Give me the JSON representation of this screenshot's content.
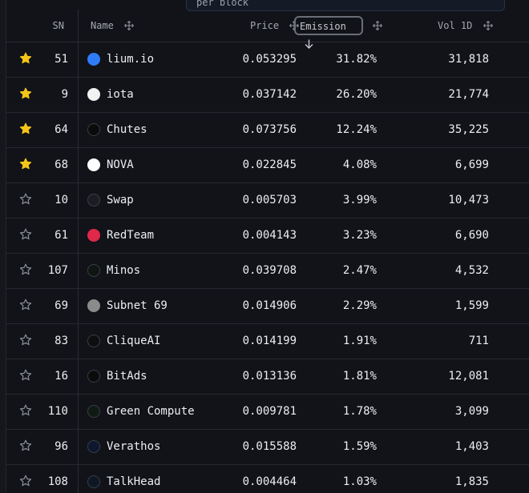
{
  "tooltip": {
    "text": "per block"
  },
  "header": {
    "sn": "SN",
    "name": "Name",
    "price": "Price",
    "emission": "Emission",
    "vol": "Vol 1D"
  },
  "rows": [
    {
      "starred": true,
      "sn": "51",
      "name": "lium.io",
      "price": "0.053295",
      "emission": "31.82%",
      "vol": "31,818",
      "icon_color": "#2f7df6",
      "icon": "cloud-logo-icon"
    },
    {
      "starred": true,
      "sn": "9",
      "name": "iota",
      "price": "0.037142",
      "emission": "26.20%",
      "vol": "21,774",
      "icon_color": "#f2f2f2",
      "icon": "iota-logo-icon"
    },
    {
      "starred": true,
      "sn": "64",
      "name": "Chutes",
      "price": "0.073756",
      "emission": "12.24%",
      "vol": "35,225",
      "icon_color": "#0b0b0b",
      "icon": "chutes-logo-icon"
    },
    {
      "starred": true,
      "sn": "68",
      "name": "NOVA",
      "price": "0.022845",
      "emission": "4.08%",
      "vol": "6,699",
      "icon_color": "#ffffff",
      "icon": "nova-logo-icon"
    },
    {
      "starred": false,
      "sn": "10",
      "name": "Swap",
      "price": "0.005703",
      "emission": "3.99%",
      "vol": "10,473",
      "icon_color": "#1b1d22",
      "icon": "swap-logo-icon"
    },
    {
      "starred": false,
      "sn": "61",
      "name": "RedTeam",
      "price": "0.004143",
      "emission": "3.23%",
      "vol": "6,690",
      "icon_color": "#e0284a",
      "icon": "redteam-logo-icon"
    },
    {
      "starred": false,
      "sn": "107",
      "name": "Minos",
      "price": "0.039708",
      "emission": "2.47%",
      "vol": "4,532",
      "icon_color": "#0f1511",
      "icon": "minos-logo-icon"
    },
    {
      "starred": false,
      "sn": "69",
      "name": "Subnet 69",
      "price": "0.014906",
      "emission": "2.29%",
      "vol": "1,599",
      "icon_color": "#8b8b8b",
      "icon": "subnet-placeholder-icon"
    },
    {
      "starred": false,
      "sn": "83",
      "name": "CliqueAI",
      "price": "0.014199",
      "emission": "1.91%",
      "vol": "711",
      "icon_color": "#0e0e0e",
      "icon": "cliqueai-logo-icon"
    },
    {
      "starred": false,
      "sn": "16",
      "name": "BitAds",
      "price": "0.013136",
      "emission": "1.81%",
      "vol": "12,081",
      "icon_color": "#0b0b0b",
      "icon": "bitads-logo-icon"
    },
    {
      "starred": false,
      "sn": "110",
      "name": "Green Compute",
      "price": "0.009781",
      "emission": "1.78%",
      "vol": "3,099",
      "icon_color": "#0f1a14",
      "icon": "green-compute-logo-icon"
    },
    {
      "starred": false,
      "sn": "96",
      "name": "Verathos",
      "price": "0.015588",
      "emission": "1.59%",
      "vol": "1,403",
      "icon_color": "#0d1730",
      "icon": "verathos-logo-icon"
    },
    {
      "starred": false,
      "sn": "108",
      "name": "TalkHead",
      "price": "0.004464",
      "emission": "1.03%",
      "vol": "1,835",
      "icon_color": "#0d1725",
      "icon": "talkhead-logo-icon"
    }
  ],
  "colors": {
    "star_filled": "#f5c518",
    "star_outline": "#8a8e96",
    "background": "#111318"
  }
}
